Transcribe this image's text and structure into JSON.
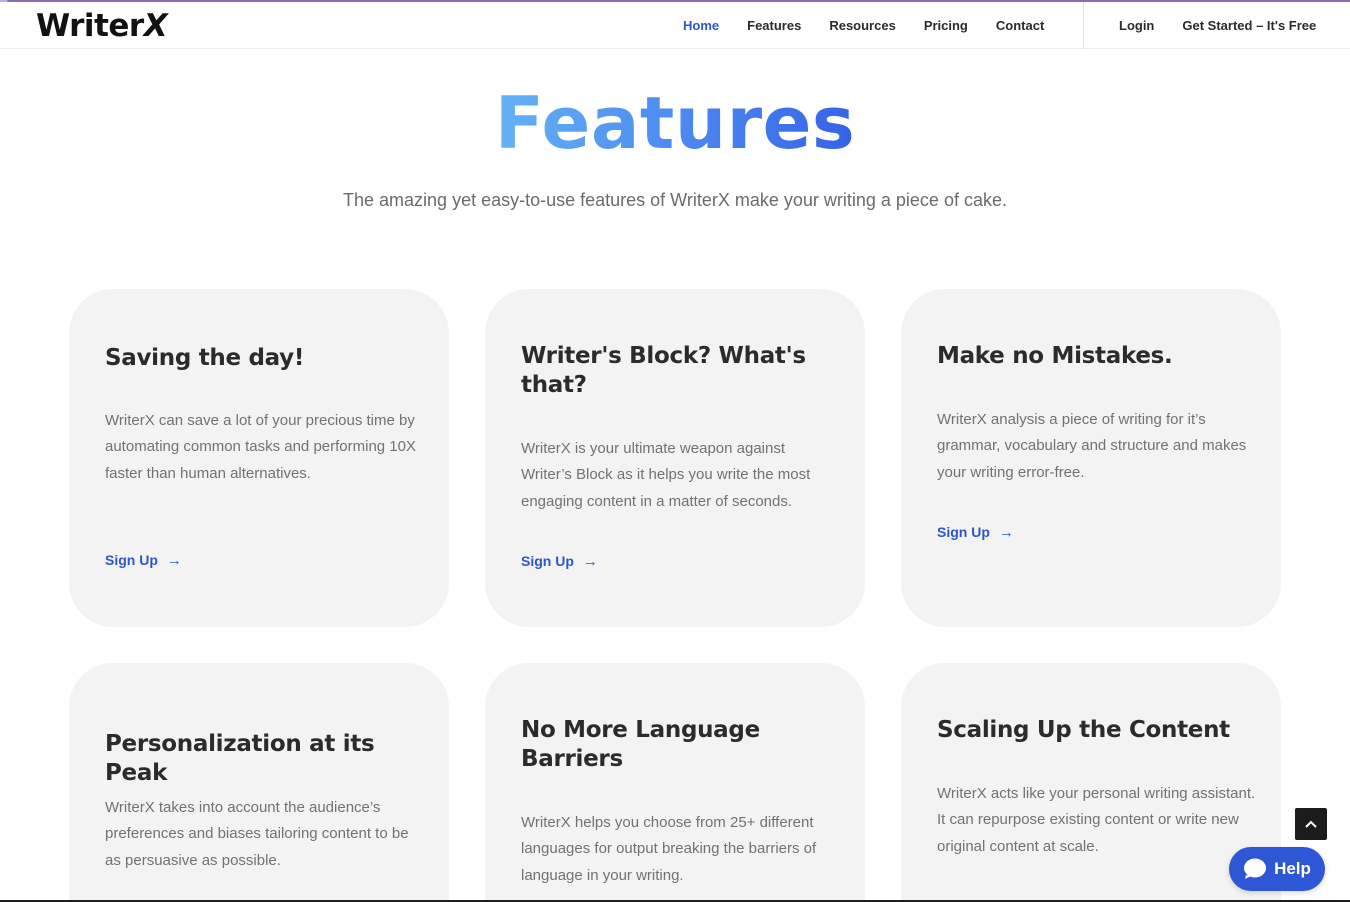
{
  "brand": {
    "logo_text": "Writer",
    "logo_x": "X"
  },
  "nav": {
    "items": [
      {
        "label": "Home",
        "active": true
      },
      {
        "label": "Features",
        "active": false
      },
      {
        "label": "Resources",
        "active": false
      },
      {
        "label": "Pricing",
        "active": false
      },
      {
        "label": "Contact",
        "active": false
      }
    ],
    "login": "Login",
    "get_started": "Get Started – It's Free"
  },
  "hero": {
    "title": "Features",
    "subtitle": "The amazing yet easy-to-use features of WriterX make your writing a piece of cake."
  },
  "cards": [
    {
      "title": "Saving the day!",
      "body": "WriterX can save a lot of your precious time by automating common tasks and performing 10X faster than human alternatives.",
      "link": "Sign Up"
    },
    {
      "title": "Writer's Block? What's that?",
      "body": "WriterX is your ultimate weapon against Writer’s Block as it helps you write the most engaging content in a matter of seconds.",
      "link": "Sign Up"
    },
    {
      "title": "Make no Mistakes.",
      "body": "WriterX analysis a piece of writing for it’s grammar, vocabulary and structure and makes your writing error-free.",
      "link": "Sign Up"
    },
    {
      "title": "Personalization at its Peak",
      "body": "WriterX takes into account the audience’s preferences and biases tailoring content to be as persuasive as possible."
    },
    {
      "title": "No More Language Barriers",
      "body": "WriterX helps you choose from 25+ different languages for output breaking the barriers of language in your writing."
    },
    {
      "title": "Scaling Up the Content",
      "body": "WriterX acts like your personal writing assistant. It can repurpose existing content or write new original content at scale."
    }
  ],
  "widgets": {
    "help_label": "Help",
    "scroll_top_icon": "chevron-up-icon",
    "chat_icon": "chat-bubble-icon"
  },
  "colors": {
    "accent": "#2d57c9",
    "card_bg": "#f3f3f3",
    "help_bg": "#2d57d4",
    "title_gradient_start": "#64b3f4",
    "title_gradient_end": "#3563e6"
  }
}
